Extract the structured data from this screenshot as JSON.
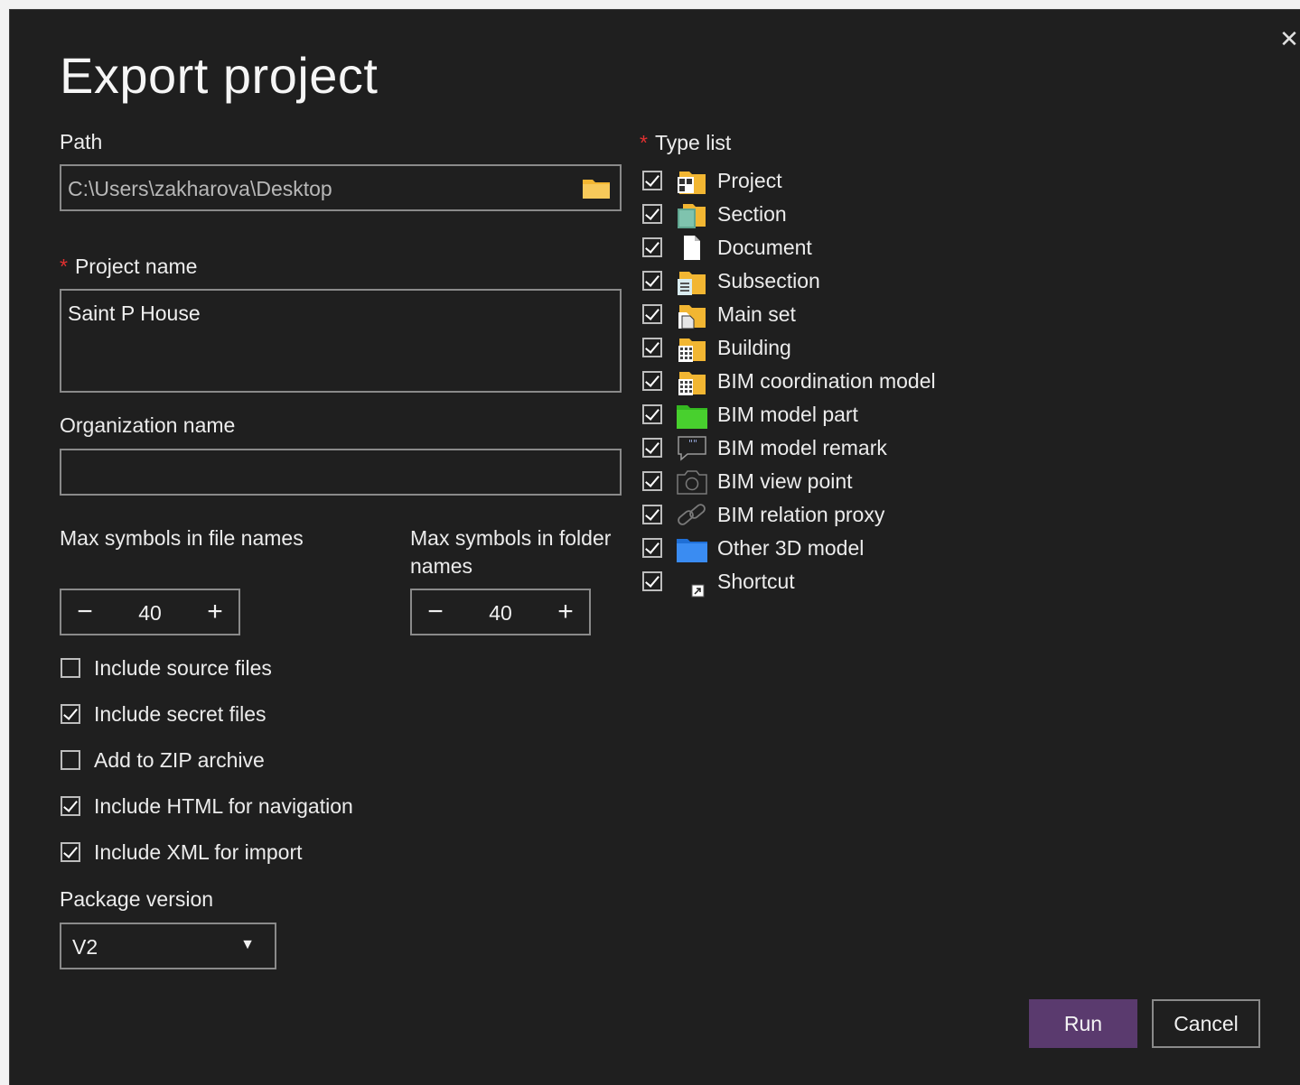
{
  "dialog": {
    "title": "Export project",
    "close_glyph": "✕"
  },
  "path": {
    "label": "Path",
    "value": "C:\\Users\\zakharova\\Desktop",
    "icon": "folder-icon"
  },
  "project_name": {
    "required_mark": "*",
    "label": "Project name",
    "value": "Saint P House"
  },
  "organization_name": {
    "label": "Organization name",
    "value": ""
  },
  "max_file_symbols": {
    "label": "Max symbols in file names",
    "value": "40",
    "minus": "−",
    "plus": "+"
  },
  "max_folder_symbols": {
    "label_line1": "Max symbols in folder",
    "label_line2": "names",
    "value": "40",
    "minus": "−",
    "plus": "+"
  },
  "options": [
    {
      "label": "Include source files",
      "checked": false
    },
    {
      "label": "Include secret files",
      "checked": true
    },
    {
      "label": "Add to ZIP archive",
      "checked": false
    },
    {
      "label": "Include HTML for navigation",
      "checked": true
    },
    {
      "label": "Include XML for import",
      "checked": true
    }
  ],
  "package_version": {
    "label": "Package version",
    "selected": "V2",
    "caret": "▼"
  },
  "type_list": {
    "required_mark": "*",
    "label": "Type list",
    "items": [
      {
        "label": "Project",
        "checked": true,
        "icon": "project-folder-icon"
      },
      {
        "label": "Section",
        "checked": true,
        "icon": "section-icon"
      },
      {
        "label": "Document",
        "checked": true,
        "icon": "document-icon"
      },
      {
        "label": "Subsection",
        "checked": true,
        "icon": "subsection-folder-icon"
      },
      {
        "label": "Main set",
        "checked": true,
        "icon": "main-set-folder-icon"
      },
      {
        "label": "Building",
        "checked": true,
        "icon": "building-folder-icon"
      },
      {
        "label": "BIM coordination model",
        "checked": true,
        "icon": "bim-coordination-folder-icon"
      },
      {
        "label": "BIM model part",
        "checked": true,
        "icon": "green-folder-icon"
      },
      {
        "label": "BIM model remark",
        "checked": true,
        "icon": "speech-bubble-icon"
      },
      {
        "label": "BIM view point",
        "checked": true,
        "icon": "camera-icon"
      },
      {
        "label": "BIM relation proxy",
        "checked": true,
        "icon": "link-icon"
      },
      {
        "label": "Other 3D model",
        "checked": true,
        "icon": "blue-folder-icon"
      },
      {
        "label": "Shortcut",
        "checked": true,
        "icon": "shortcut-icon"
      }
    ]
  },
  "buttons": {
    "run": "Run",
    "cancel": "Cancel"
  },
  "colors": {
    "background": "#1f1f1f",
    "accent": "#5a3a6e",
    "required": "#e03030",
    "folder_yellow": "#f2b632",
    "folder_green": "#3fc52b",
    "folder_blue": "#2f86f0"
  }
}
